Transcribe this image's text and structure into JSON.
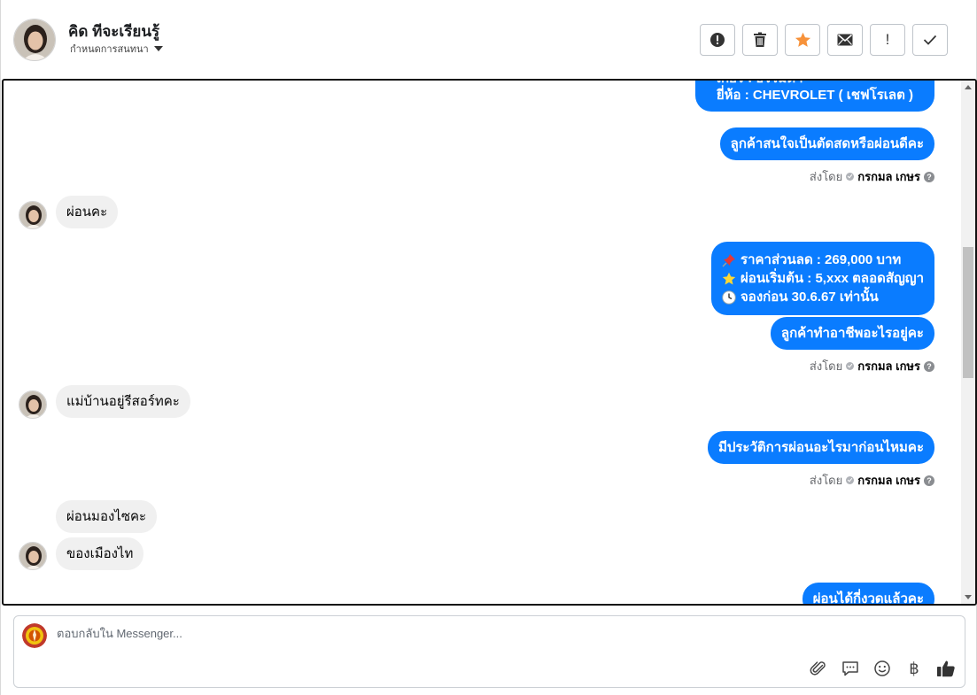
{
  "header": {
    "contact_name": "คิด ทีจะเรียนรู้",
    "subtitle": "กำหนดการสนทนา"
  },
  "toolbar": {
    "buttons": [
      "alert-circle-icon",
      "trash-icon",
      "star-icon",
      "envelope-icon",
      "exclamation-icon",
      "check-icon"
    ],
    "exclamation_label": "!",
    "star_color": "#f7923a"
  },
  "chat": {
    "partial_top_line": "เกียร์ : ธรรมดา",
    "messages": [
      {
        "dir": "out",
        "lines": [
          "ยี่ห้อ : CHEVROLET ( เชฟโรเลต )"
        ]
      },
      {
        "dir": "out",
        "text": "ลูกค้าสนใจเป็นตัดสดหรือผ่อนดีคะ"
      },
      {
        "dir": "in",
        "text": "ผ่อนคะ"
      },
      {
        "dir": "out",
        "lines": [
          "ราคาส่วนลด : 269,000 บาท",
          "ผ่อนเริ่มต้น : 5,xxx ตลอดสัญญา",
          "จองก่อน 30.6.67 เท่านั้น"
        ]
      },
      {
        "dir": "out",
        "text": "ลูกค้าทำอาชีพอะไรอยู่คะ"
      },
      {
        "dir": "in",
        "text": "แม่บ้านอยู่รีสอร์ทคะ"
      },
      {
        "dir": "out",
        "text": "มีประวัติการผ่อนอะไรมาก่อนไหมคะ"
      },
      {
        "dir": "in",
        "text": "ผ่อนมองไซคะ"
      },
      {
        "dir": "in",
        "text": "ของเมืองไท"
      },
      {
        "dir": "out",
        "text": "ผ่อนได้กี่งวดแล้วคะ"
      }
    ],
    "sent_by_label": "ส่งโดย",
    "sent_by_name": "กรกมล เกษร",
    "accent_color": "#0a7cff"
  },
  "composer": {
    "placeholder": "ตอบกลับใน Messenger...",
    "tools": [
      "paperclip-icon",
      "chat-icon",
      "smiley-icon",
      "baht-icon",
      "thumbs-up-icon"
    ],
    "baht_symbol": "฿"
  }
}
